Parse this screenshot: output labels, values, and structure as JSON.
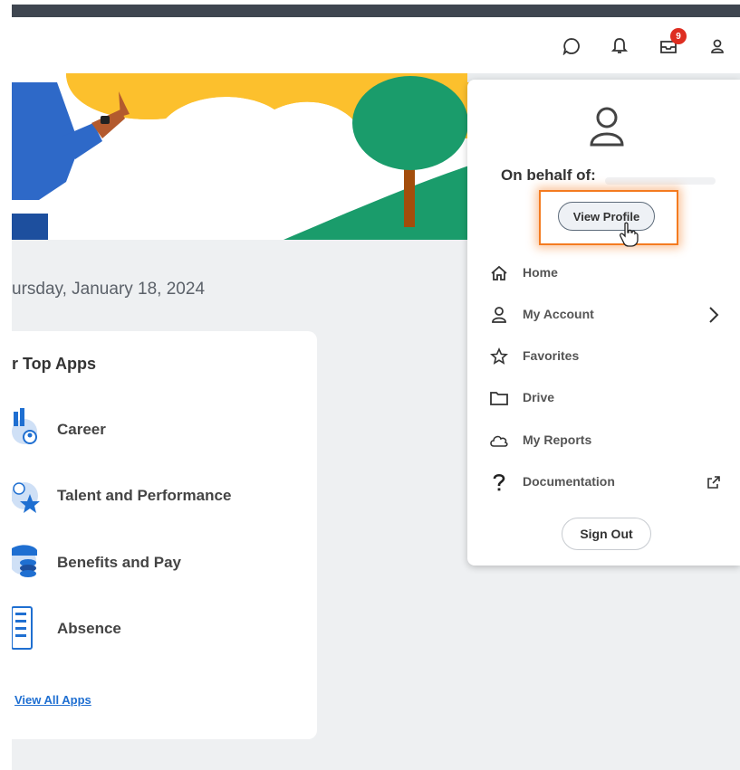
{
  "header": {
    "notification_count": "9",
    "icons": [
      "chat-icon",
      "bell-icon",
      "inbox-icon",
      "user-icon"
    ]
  },
  "main": {
    "date_text": "ursday, January 18, 2024",
    "apps_title": "r Top Apps",
    "apps": [
      {
        "label": "Career",
        "icon": "career-icon"
      },
      {
        "label": "Talent and Performance",
        "icon": "talent-icon"
      },
      {
        "label": "Benefits and Pay",
        "icon": "benefits-icon"
      },
      {
        "label": "Absence",
        "icon": "absence-icon"
      }
    ],
    "view_all": "View All Apps"
  },
  "dropdown": {
    "on_behalf_label": "On behalf of:",
    "view_profile": "View Profile",
    "menu": [
      {
        "label": "Home",
        "icon": "home-icon"
      },
      {
        "label": "My Account",
        "icon": "user-icon",
        "right": "chevron-right-icon"
      },
      {
        "label": "Favorites",
        "icon": "star-icon"
      },
      {
        "label": "Drive",
        "icon": "folder-icon"
      },
      {
        "label": "My Reports",
        "icon": "cloud-icon"
      },
      {
        "label": "Documentation",
        "icon": "help-icon",
        "right": "external-link-icon"
      }
    ],
    "sign_out": "Sign Out"
  },
  "colors": {
    "accent": "#f47b20",
    "link": "#1f6fd1",
    "badge": "#de2e21",
    "banner_green": "#1a9c6b",
    "banner_yellow": "#fcc02d"
  }
}
